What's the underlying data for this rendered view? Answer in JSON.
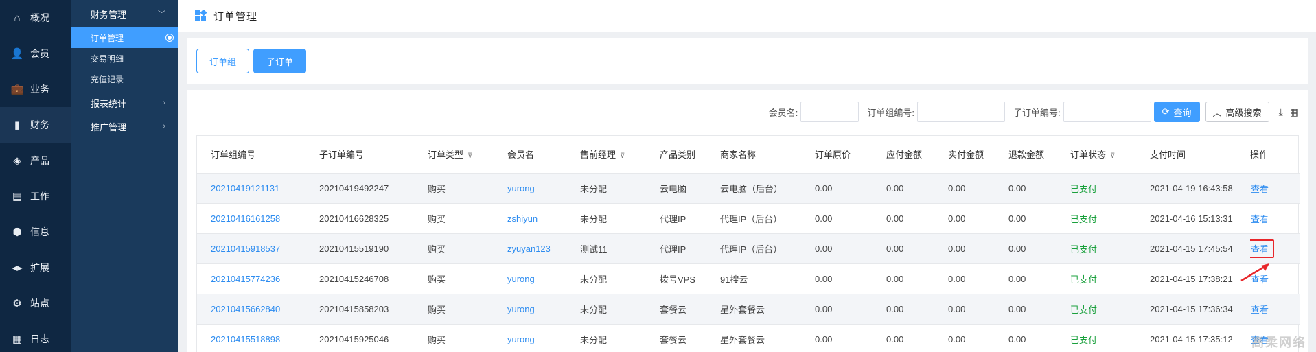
{
  "nav_primary": [
    {
      "label": "概况",
      "icon": "home-icon",
      "glyph": "⌂",
      "active": false
    },
    {
      "label": "会员",
      "icon": "user-icon",
      "glyph": "👤",
      "active": false
    },
    {
      "label": "业务",
      "icon": "briefcase-icon",
      "glyph": "💼",
      "active": false
    },
    {
      "label": "财务",
      "icon": "bar-chart-icon",
      "glyph": "▮",
      "active": true
    },
    {
      "label": "产品",
      "icon": "box-icon",
      "glyph": "◈",
      "active": false
    },
    {
      "label": "工作",
      "icon": "clipboard-icon",
      "glyph": "▤",
      "active": false
    },
    {
      "label": "信息",
      "icon": "cube-icon",
      "glyph": "⬢",
      "active": false
    },
    {
      "label": "扩展",
      "icon": "code-icon",
      "glyph": "◂▸",
      "active": false
    },
    {
      "label": "站点",
      "icon": "gear-icon",
      "glyph": "⚙",
      "active": false
    },
    {
      "label": "日志",
      "icon": "calendar-icon",
      "glyph": "▦",
      "active": false
    }
  ],
  "nav_secondary": {
    "group1": "财务管理",
    "items": [
      "订单管理",
      "交易明细",
      "充值记录"
    ],
    "group2": "报表统计",
    "group3": "推广管理"
  },
  "header": {
    "title": "订单管理"
  },
  "tabs": [
    "订单组",
    "子订单"
  ],
  "search": {
    "member_label": "会员名:",
    "group_no_label": "订单组编号:",
    "sub_no_label": "子订单编号:",
    "query_label": "查询",
    "advanced_label": "高级搜索"
  },
  "table": {
    "headers": [
      "订单组编号",
      "子订单编号",
      "订单类型",
      "会员名",
      "售前经理",
      "产品类别",
      "商家名称",
      "订单原价",
      "应付金额",
      "实付金额",
      "退款金额",
      "订单状态",
      "支付时间",
      "操作"
    ],
    "rows": [
      [
        "20210419121131",
        "20210419492247",
        "购买",
        "yurong",
        "未分配",
        "云电脑",
        "云电脑（后台）",
        "0.00",
        "0.00",
        "0.00",
        "0.00",
        "已支付",
        "2021-04-19 16:43:58",
        "查看"
      ],
      [
        "20210416161258",
        "20210416628325",
        "购买",
        "zshiyun",
        "未分配",
        "代理IP",
        "代理IP（后台）",
        "0.00",
        "0.00",
        "0.00",
        "0.00",
        "已支付",
        "2021-04-16 15:13:31",
        "查看"
      ],
      [
        "20210415918537",
        "20210415519190",
        "购买",
        "zyuyan123",
        "测试11",
        "代理IP",
        "代理IP（后台）",
        "0.00",
        "0.00",
        "0.00",
        "0.00",
        "已支付",
        "2021-04-15 17:45:54",
        "查看"
      ],
      [
        "20210415774236",
        "20210415246708",
        "购买",
        "yurong",
        "未分配",
        "拨号VPS",
        "91搜云",
        "0.00",
        "0.00",
        "0.00",
        "0.00",
        "已支付",
        "2021-04-15 17:38:21",
        "查看"
      ],
      [
        "20210415662840",
        "20210415858203",
        "购买",
        "yurong",
        "未分配",
        "套餐云",
        "星外套餐云",
        "0.00",
        "0.00",
        "0.00",
        "0.00",
        "已支付",
        "2021-04-15 17:36:34",
        "查看"
      ],
      [
        "20210415518898",
        "20210415925046",
        "购买",
        "yurong",
        "未分配",
        "套餐云",
        "星外套餐云",
        "0.00",
        "0.00",
        "0.00",
        "0.00",
        "已支付",
        "2021-04-15 17:35:12",
        "查看"
      ]
    ]
  },
  "watermark": "高柔网络",
  "colors": {
    "accent": "#409eff",
    "paid": "#19a03c",
    "highlight": "#e8272b",
    "sidebar": "#0f2742"
  }
}
